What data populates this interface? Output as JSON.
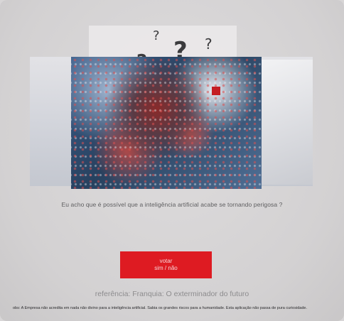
{
  "scene": {
    "question": "Eu acho que é possível que a inteligência artificial acabe se tornando perigosa ?",
    "button": {
      "line1": "votar",
      "line2": "sim / não"
    },
    "reference": "referência: Franquia: O exterminador do futuro",
    "footnote": "obs: A Empresa não acredita em nada não divino para a inteligência artificial. Sabia os grandes riscos para a humanidade. Esta aplicação não passa de pura curiosidade."
  },
  "icons": {
    "question_marks": [
      "?",
      "?",
      "?",
      "?",
      "?",
      "?"
    ]
  },
  "colors": {
    "accent": "#de1b22",
    "background": "#d8d6d7"
  }
}
